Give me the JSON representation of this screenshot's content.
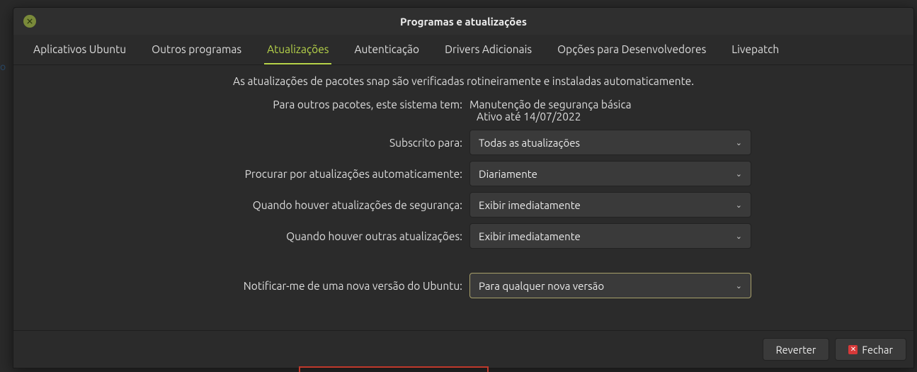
{
  "window": {
    "title": "Programas e atualizações"
  },
  "tabs": [
    {
      "label": "Aplicativos Ubuntu",
      "active": false
    },
    {
      "label": "Outros programas",
      "active": false
    },
    {
      "label": "Atualizações",
      "active": true
    },
    {
      "label": "Autenticação",
      "active": false
    },
    {
      "label": "Drivers Adicionais",
      "active": false
    },
    {
      "label": "Opções para Desenvolvedores",
      "active": false
    },
    {
      "label": "Livepatch",
      "active": false
    }
  ],
  "content": {
    "notice": "As atualizações de pacotes snap são verificadas rotineiramente e instaladas automaticamente.",
    "system_label": "Para outros pacotes, este sistema tem:",
    "system_value": "Manutenção de segurança básica",
    "active_until": "Ativo até 14/07/2022",
    "rows": {
      "subscribed": {
        "label": "Subscrito para:",
        "value": "Todas as atualizações"
      },
      "check_auto": {
        "label": "Procurar por atualizações automaticamente:",
        "value": "Diariamente"
      },
      "security_updates": {
        "label": "Quando houver atualizações de segurança:",
        "value": "Exibir imediatamente"
      },
      "other_updates": {
        "label": "Quando houver outras atualizações:",
        "value": "Exibir imediatamente"
      },
      "notify_version": {
        "label": "Notificar-me de uma nova versão do Ubuntu:",
        "value": "Para qualquer nova versão"
      }
    }
  },
  "footer": {
    "revert": "Reverter",
    "close": "Fechar"
  }
}
